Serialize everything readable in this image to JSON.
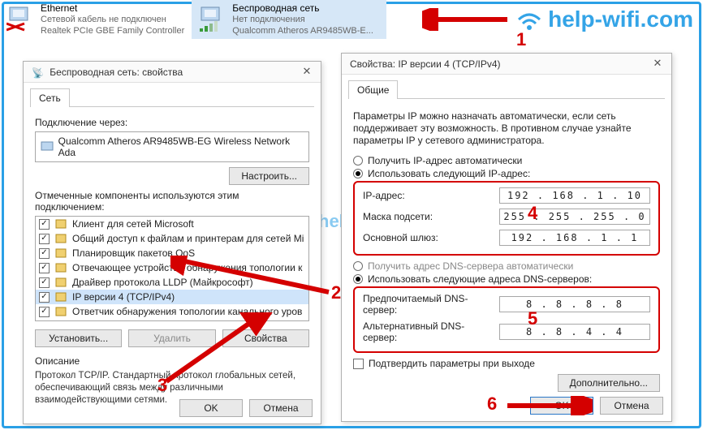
{
  "adapters": [
    {
      "name": "Ethernet",
      "status": "Сетевой кабель не подключен",
      "device": "Realtek PCIe GBE Family Controller"
    },
    {
      "name": "Беспроводная сеть",
      "status": "Нет подключения",
      "device": "Qualcomm Atheros AR9485WB-E..."
    }
  ],
  "watermark": "help-wifi.com",
  "dlg1": {
    "title": "Беспроводная сеть: свойства",
    "tab": "Сеть",
    "connect_via_label": "Подключение через:",
    "adapter": "Qualcomm Atheros AR9485WB-EG Wireless Network Ada",
    "configure_btn": "Настроить...",
    "components_label": "Отмеченные компоненты используются этим подключением:",
    "items": [
      {
        "checked": true,
        "label": "Клиент для сетей Microsoft"
      },
      {
        "checked": true,
        "label": "Общий доступ к файлам и принтерам для сетей Mi"
      },
      {
        "checked": true,
        "label": "Планировщик пакетов QoS"
      },
      {
        "checked": true,
        "label": "Отвечающее устройство обнаружения топологии к"
      },
      {
        "checked": true,
        "label": "Драйвер протокола LLDP (Майкрософт)"
      },
      {
        "checked": true,
        "label": "IP версии 4 (TCP/IPv4)"
      },
      {
        "checked": true,
        "label": "Ответчик обнаружения топологии канального уров"
      }
    ],
    "install_btn": "Установить...",
    "remove_btn": "Удалить",
    "props_btn": "Свойства",
    "desc_title": "Описание",
    "desc": "Протокол TCP/IP. Стандартный протокол глобальных сетей, обеспечивающий связь между различными взаимодействующими сетями.",
    "ok": "OK",
    "cancel": "Отмена"
  },
  "dlg2": {
    "title": "Свойства: IP версии 4 (TCP/IPv4)",
    "tab": "Общие",
    "para": "Параметры IP можно назначать автоматически, если сеть поддерживает эту возможность. В противном случае узнайте параметры IP у сетевого администратора.",
    "radio_auto_ip": "Получить IP-адрес автоматически",
    "radio_use_ip": "Использовать следующий IP-адрес:",
    "ip_label": "IP-адрес:",
    "mask_label": "Маска подсети:",
    "gw_label": "Основной шлюз:",
    "ip": "192 . 168 .  1  . 10",
    "mask": "255 . 255 . 255 .  0",
    "gw": "192 . 168 .  1  .  1",
    "radio_auto_dns": "Получить адрес DNS-сервера автоматически",
    "radio_use_dns": "Использовать следующие адреса DNS-серверов:",
    "dns1_label": "Предпочитаемый DNS-сервер:",
    "dns2_label": "Альтернативный DNS-сервер:",
    "dns1": "8  .  8  .  8  .  8",
    "dns2": "8  .  8  .  4  .  4",
    "confirm": "Подтвердить параметры при выходе",
    "advanced": "Дополнительно...",
    "ok": "OK",
    "cancel": "Отмена"
  },
  "num": {
    "n1": "1",
    "n2": "2",
    "n3": "3",
    "n4": "4",
    "n5": "5",
    "n6": "6"
  }
}
